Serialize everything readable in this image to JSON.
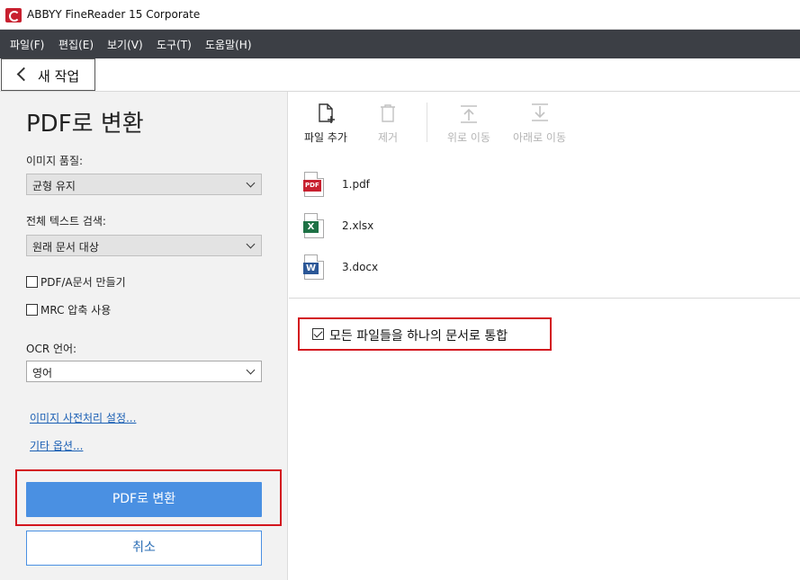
{
  "window": {
    "title": "ABBYY FineReader 15 Corporate"
  },
  "menu": [
    "파일(F)",
    "편집(E)",
    "보기(V)",
    "도구(T)",
    "도움말(H)"
  ],
  "nav": {
    "back_label": "새 작업"
  },
  "panel": {
    "title": "PDF로 변환",
    "image_quality_label": "이미지 품질:",
    "image_quality_value": "균형 유지",
    "fulltext_label": "전체 텍스트 검색:",
    "fulltext_value": "원래 문서 대상",
    "pdfa_label": "PDF/A문서 만들기",
    "pdfa_checked": false,
    "mrc_label": "MRC 압축 사용",
    "mrc_checked": false,
    "ocr_label": "OCR 언어:",
    "ocr_value": "영어",
    "link_preprocess": "이미지 사전처리 설정...",
    "link_other": "기타 옵션...",
    "convert_button": "PDF로 변환",
    "cancel_button": "취소"
  },
  "tools": {
    "add_file": "파일 추가",
    "remove": "제거",
    "move_up": "위로 이동",
    "move_down": "아래로 이동"
  },
  "files": [
    {
      "name": "1.pdf",
      "badge": "PDF",
      "color": "#c8202f",
      "icon": "pdf-file-icon"
    },
    {
      "name": "2.xlsx",
      "badge": "X",
      "color": "#1e7145",
      "icon": "excel-file-icon"
    },
    {
      "name": "3.docx",
      "badge": "W",
      "color": "#2b5797",
      "icon": "word-file-icon"
    }
  ],
  "merge": {
    "label": "모든 파일들을 하나의 문서로 통합",
    "checked": true
  },
  "colors": {
    "menubar": "#3c3f45",
    "accent": "#4a90e2",
    "highlight": "#d3151e"
  }
}
